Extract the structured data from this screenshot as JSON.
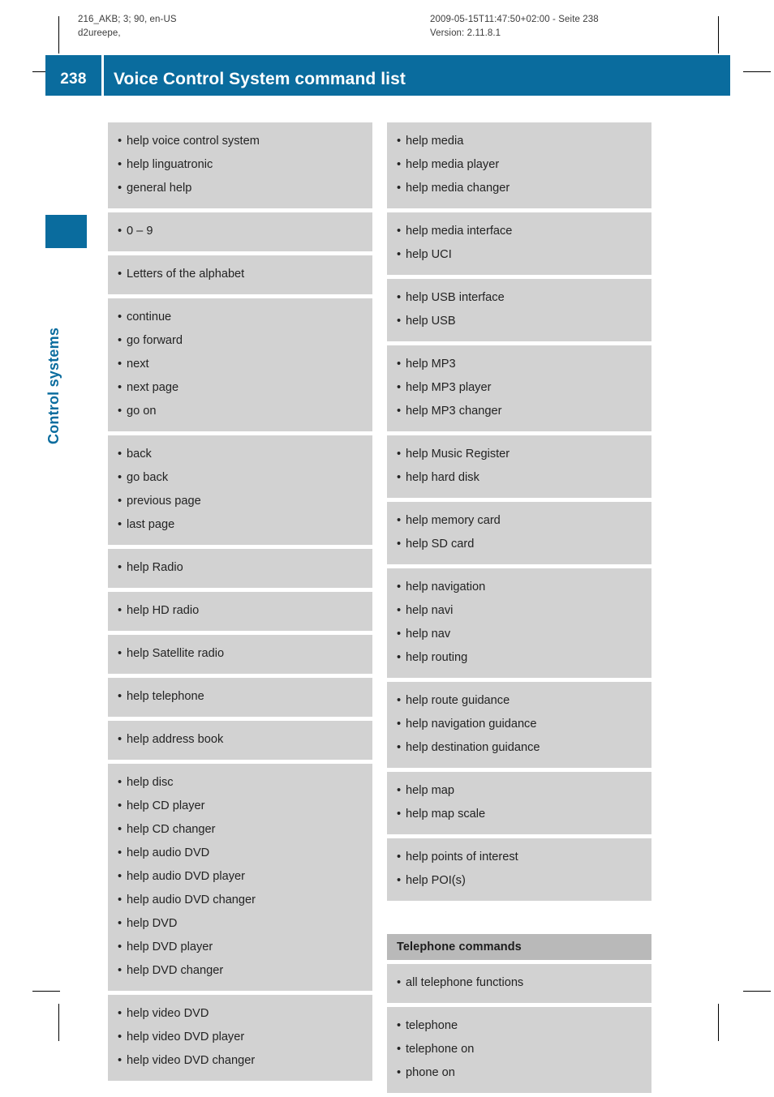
{
  "print_meta": {
    "left_line1": "216_AKB; 3; 90, en-US",
    "left_line2": "d2ureepe,",
    "right_line1": "2009-05-15T11:47:50+02:00 - Seite 238",
    "right_line2": "Version: 2.11.8.1"
  },
  "header": {
    "page_number": "238",
    "title": "Voice Control System command list",
    "accent_color": "#0a6c9e"
  },
  "chapter": {
    "label": "Control systems"
  },
  "colors": {
    "cell_background": "#d2d2d2",
    "group_header_background": "#b9b9b9",
    "text": "#232323"
  },
  "bullet": "•",
  "left_column": {
    "groups": [
      {
        "type": "list",
        "items": [
          "help voice control system",
          "help linguatronic",
          "general help"
        ]
      },
      {
        "type": "list",
        "items": [
          "0 – 9"
        ]
      },
      {
        "type": "list",
        "items": [
          "Letters of the alphabet"
        ]
      },
      {
        "type": "list",
        "items": [
          "continue",
          "go forward",
          "next",
          "next page",
          "go on"
        ]
      },
      {
        "type": "list",
        "items": [
          "back",
          "go back",
          "previous page",
          "last page"
        ]
      },
      {
        "type": "list",
        "items": [
          "help Radio"
        ]
      },
      {
        "type": "list",
        "items": [
          "help HD radio"
        ]
      },
      {
        "type": "list",
        "items": [
          "help Satellite radio"
        ]
      },
      {
        "type": "list",
        "items": [
          "help telephone"
        ]
      },
      {
        "type": "list",
        "items": [
          "help address book"
        ]
      },
      {
        "type": "list",
        "items": [
          "help disc",
          "help CD player",
          "help CD changer",
          "help audio DVD",
          "help audio DVD player",
          "help audio DVD changer",
          "help DVD",
          "help DVD player",
          "help DVD changer"
        ]
      },
      {
        "type": "list",
        "items": [
          "help video DVD",
          "help video DVD player",
          "help video DVD changer"
        ]
      }
    ]
  },
  "right_column": {
    "groups": [
      {
        "type": "list",
        "items": [
          "help media",
          "help media player",
          "help media changer"
        ]
      },
      {
        "type": "list",
        "items": [
          "help media interface",
          "help UCI"
        ]
      },
      {
        "type": "list",
        "items": [
          "help USB interface",
          "help USB"
        ]
      },
      {
        "type": "list",
        "items": [
          "help MP3",
          "help MP3 player",
          "help MP3 changer"
        ]
      },
      {
        "type": "list",
        "items": [
          "help Music Register",
          "help hard disk"
        ]
      },
      {
        "type": "list",
        "items": [
          "help memory card",
          "help SD card"
        ]
      },
      {
        "type": "list",
        "items": [
          "help navigation",
          "help navi",
          "help nav",
          "help routing"
        ]
      },
      {
        "type": "list",
        "items": [
          "help route guidance",
          "help navigation guidance",
          "help destination guidance"
        ]
      },
      {
        "type": "list",
        "items": [
          "help map",
          "help map scale"
        ]
      },
      {
        "type": "list",
        "items": [
          "help points of interest",
          "help POI(s)"
        ]
      },
      {
        "type": "spacer"
      },
      {
        "type": "header",
        "title": "Telephone commands"
      },
      {
        "type": "list",
        "items": [
          "all telephone functions"
        ]
      },
      {
        "type": "list",
        "items": [
          "telephone",
          "telephone on",
          "phone on"
        ]
      }
    ]
  }
}
